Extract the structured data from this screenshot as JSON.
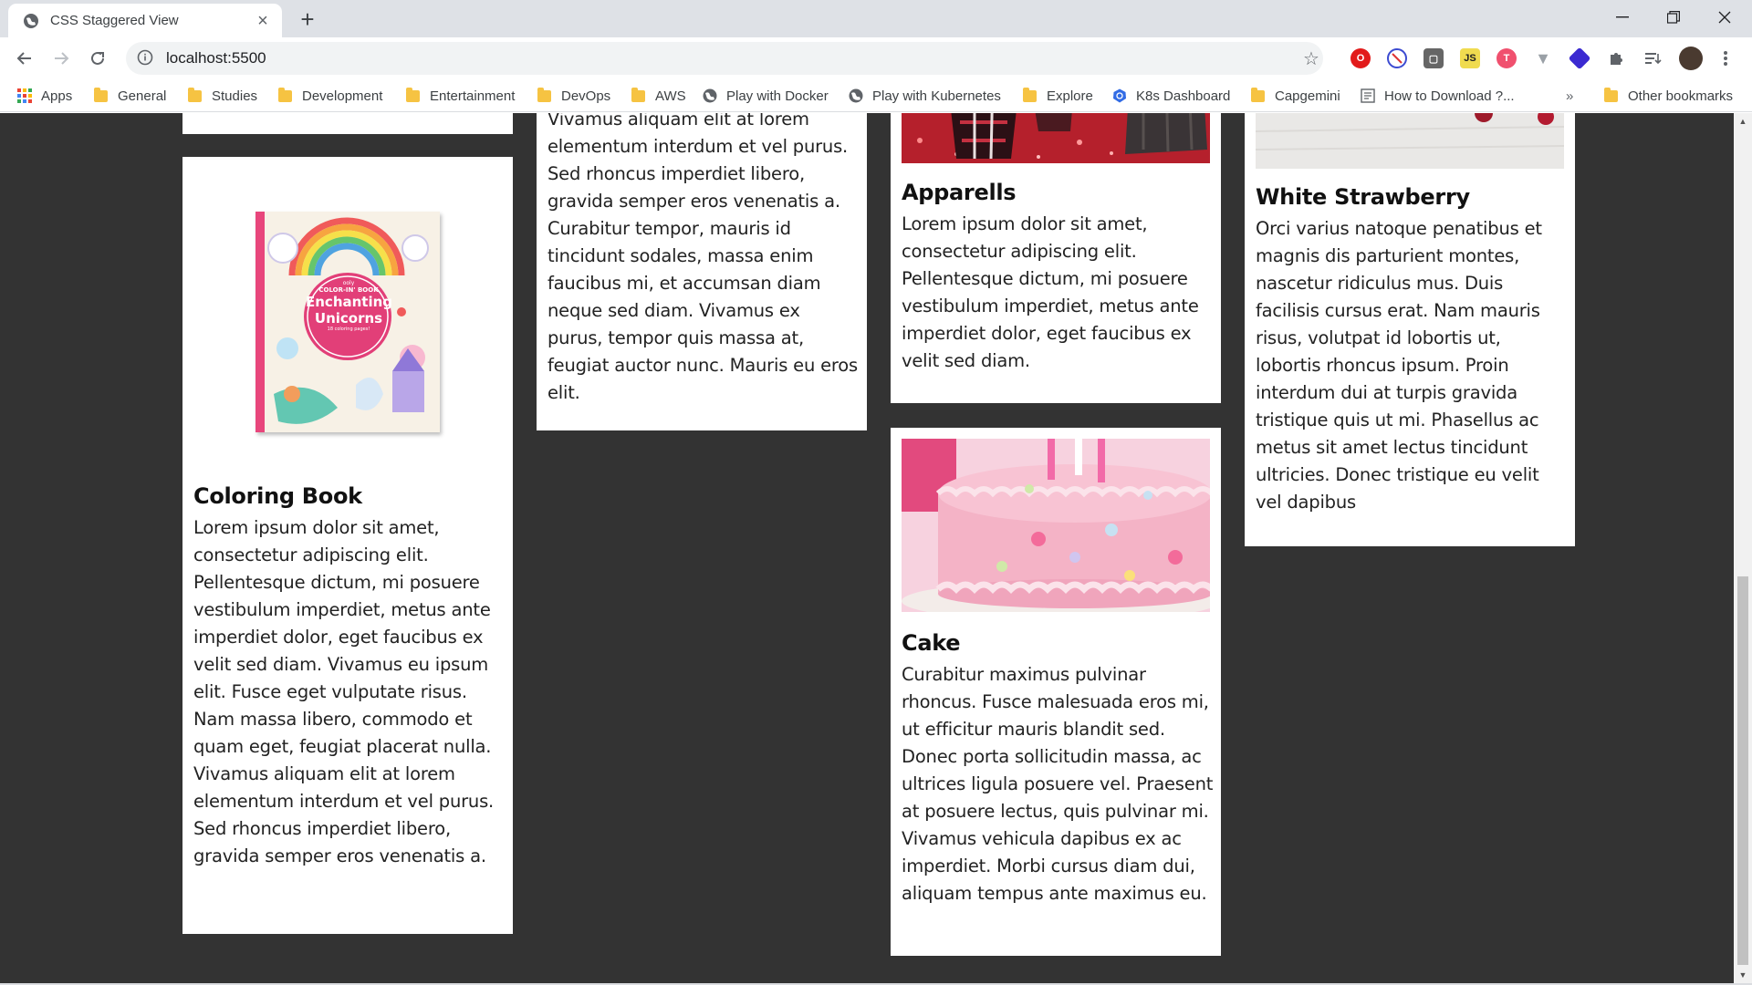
{
  "browser": {
    "tab_title": "CSS Staggered View",
    "url": "localhost:5500",
    "bookmarks": [
      {
        "label": "Apps",
        "icon": "apps-grid-icon"
      },
      {
        "label": "General",
        "icon": "folder-icon"
      },
      {
        "label": "Studies",
        "icon": "folder-icon"
      },
      {
        "label": "Development",
        "icon": "folder-icon"
      },
      {
        "label": "Entertainment",
        "icon": "folder-icon"
      },
      {
        "label": "DevOps",
        "icon": "folder-icon"
      },
      {
        "label": "AWS",
        "icon": "folder-icon"
      },
      {
        "label": "Play with Docker",
        "icon": "globe-icon"
      },
      {
        "label": "Play with Kubernetes",
        "icon": "globe-icon"
      },
      {
        "label": "Explore",
        "icon": "folder-icon"
      },
      {
        "label": "K8s Dashboard",
        "icon": "kubernetes-icon"
      },
      {
        "label": "Capgemini",
        "icon": "folder-icon"
      },
      {
        "label": "How to Download ?...",
        "icon": "page-icon"
      }
    ],
    "overflow_label": "»",
    "other_bookmarks": "Other bookmarks"
  },
  "cards": {
    "top_fragment": {
      "text": "Vivamus aliquam elit at lorem elementum interdum et vel purus. Sed rhoncus imperdiet libero, gravida semper eros venenatis a. Curabitur tempor, mauris id tincidunt sodales, massa enim faucibus mi, et accumsan diam neque sed diam. Vivamus ex purus, tempor quis massa at, feugiat auctor nunc. Mauris eu eros elit."
    },
    "coloring_book": {
      "title": "Coloring Book",
      "book_brand": "ooly",
      "book_line1": "COLOR-IN' BOOK",
      "book_line2": "Enchanting",
      "book_line3": "Unicorns",
      "book_line4": "18 coloring pages!",
      "text": "Lorem ipsum dolor sit amet, consectetur adipiscing elit. Pellentesque dictum, mi posuere vestibulum imperdiet, metus ante imperdiet dolor, eget faucibus ex velit sed diam. Vivamus eu ipsum elit. Fusce eget vulputate risus. Nam massa libero, commodo et quam eget, feugiat placerat nulla. Vivamus aliquam elit at lorem elementum interdum et vel purus. Sed rhoncus imperdiet libero, gravida semper eros venenatis a."
    },
    "apparells": {
      "title": "Apparells",
      "text": "Lorem ipsum dolor sit amet, consectetur adipiscing elit. Pellentesque dictum, mi posuere vestibulum imperdiet, metus ante imperdiet dolor, eget faucibus ex velit sed diam."
    },
    "cake": {
      "title": "Cake",
      "text": "Curabitur maximus pulvinar rhoncus. Fusce malesuada eros mi, ut efficitur mauris blandit sed. Donec porta sollicitudin massa, ac ultrices ligula posuere vel. Praesent at posuere lectus, quis pulvinar mi. Vivamus vehicula dapibus ex ac imperdiet. Morbi cursus diam dui, aliquam tempus ante maximus eu."
    },
    "white_strawberry": {
      "title": "White Strawberry",
      "text": "Orci varius natoque penatibus et magnis dis parturient montes, nascetur ridiculus mus. Duis facilisis cursus erat. Nam mauris risus, volutpat id lobortis ut, lobortis rhoncus ipsum. Proin interdum dui at turpis gravida tristique quis ut mi. Phasellus ac metus sit amet lectus tincidunt ultricies. Donec tristique eu velit vel dapibus"
    }
  },
  "colors": {
    "page_background": "#333333",
    "card_background": "#ffffff"
  }
}
